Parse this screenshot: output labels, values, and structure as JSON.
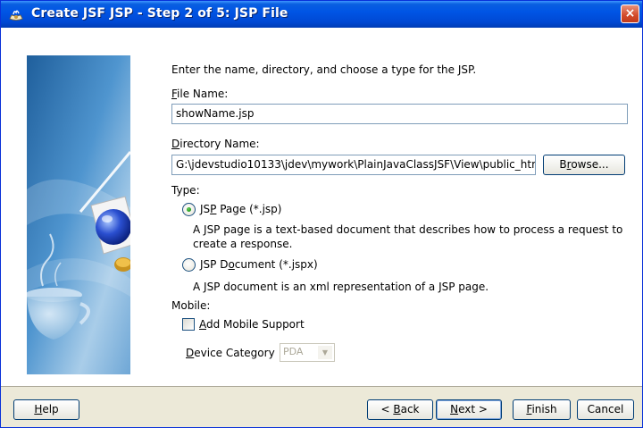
{
  "window": {
    "title": "Create JSF JSP - Step 2 of 5: JSP File",
    "close_label": "×"
  },
  "intro": "Enter the name, directory, and choose a type for the JSP.",
  "file_name": {
    "label_accel": "F",
    "label_rest": "ile Name:",
    "value": "showName.jsp"
  },
  "directory": {
    "label_accel": "D",
    "label_rest": "irectory Name:",
    "value": "G:\\jdevstudio10133\\jdev\\mywork\\PlainJavaClassJSF\\View\\public_htm",
    "browse_label_accel": "r",
    "browse_pre": "B",
    "browse_post": "owse..."
  },
  "type": {
    "label": "Type:",
    "options": [
      {
        "pre": "JS",
        "accel": "P",
        "post": " Page (*.jsp)",
        "description_line1": "A JSP page is a text-based document that describes how to process a request to",
        "description_line2": "create a response.",
        "selected": true
      },
      {
        "pre": "JSP D",
        "accel": "o",
        "post": "cument (*.jspx)",
        "description_line1": "A JSP document is an xml representation of a JSP page.",
        "selected": false
      }
    ]
  },
  "mobile": {
    "label": "Mobile:",
    "checkbox_accel": "A",
    "checkbox_rest": "dd Mobile Support",
    "checked": false,
    "device_accel": "D",
    "device_rest": "evice Category",
    "device_value": "PDA"
  },
  "footer": {
    "help_accel": "H",
    "help_rest": "elp",
    "back_pre": "< ",
    "back_accel": "B",
    "back_rest": "ack",
    "next_accel": "N",
    "next_rest": "ext >",
    "finish_accel": "F",
    "finish_rest": "inish",
    "cancel_label": "Cancel"
  },
  "colors": {
    "title_bar": "#0055e5",
    "dialog_face": "#ece9d8",
    "input_border": "#7f9db9"
  }
}
